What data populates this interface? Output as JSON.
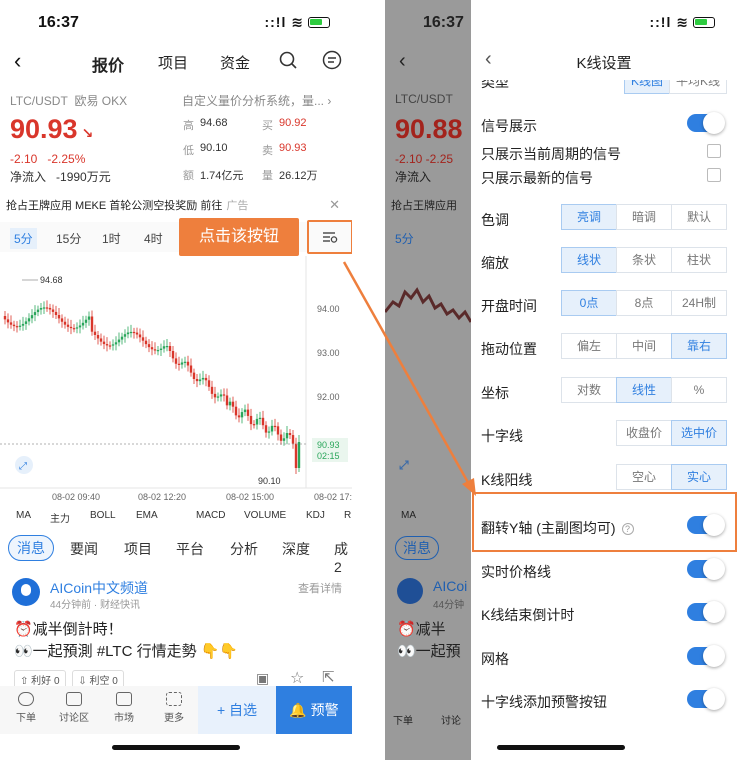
{
  "status": {
    "time": "16:37",
    "signal": "::!l"
  },
  "left": {
    "nav": {
      "tabs": [
        "报价",
        "项目",
        "资金"
      ]
    },
    "pair": "LTC/USDT",
    "exchange": "欧易 OKX",
    "custom_desc": "自定义量价分析系统，量...",
    "price": "90.93",
    "change_abs": "-2.10",
    "change_pct": "-2.25%",
    "net_inflow_label": "净流入",
    "net_inflow_value": "-1990万元",
    "stats": [
      {
        "k1": "高",
        "v1": "94.68",
        "k2": "买",
        "v2": "90.92"
      },
      {
        "k1": "低",
        "v1": "90.10",
        "k2": "卖",
        "v2": "90.93"
      },
      {
        "k1": "额",
        "v1": "1.74亿元",
        "k2": "量",
        "v2": "26.12万"
      }
    ],
    "ad_text": "抢占王牌应用 MEKE 首轮公测空投奖励 前往",
    "ad_tag": "广告",
    "periods": [
      "5分",
      "15分",
      "1时",
      "4时"
    ],
    "callout": "点击该按钮",
    "chart_labels": {
      "high": "94.68",
      "low": "90.10",
      "y_ticks": [
        "94.00",
        "93.00",
        "92.00"
      ],
      "last_price": "90.93",
      "countdown": "02:15",
      "x_ticks": [
        "08-02 09:40",
        "08-02 12:20",
        "08-02 15:00",
        "08-02 17:"
      ]
    },
    "indicators": [
      "MA",
      "主力",
      "BOLL",
      "EMA",
      "MACD",
      "VOLUME",
      "KDJ",
      "R"
    ],
    "news_tabs": [
      "消息",
      "要闻",
      "项目",
      "平台",
      "分析",
      "深度",
      "成2"
    ],
    "post": {
      "author": "AICoin中文频道",
      "meta": "44分钟前 · 财经快讯",
      "detail": "查看详情",
      "line1": "⏰减半倒計時！",
      "line2": "👀一起預測 #LTC 行情走勢 👇👇",
      "vote_up": "利好 0",
      "vote_down": "利空 0"
    },
    "bottom": [
      "下单",
      "讨论区",
      "市场",
      "更多"
    ],
    "btn_zixuan": "+ 自选",
    "btn_yujing": "🔔 预警"
  },
  "right": {
    "under_price": "90.88",
    "under_chg": "-2.10 -2.25",
    "under_flow": "净流入",
    "under_ad": "抢占王牌应用",
    "under_period": "5分",
    "under_news": "消息",
    "under_author": "AICoi",
    "under_meta": "44分钟",
    "under_line1": "⏰减半",
    "under_line2": "👀一起預",
    "under_bottom1": "下单",
    "under_bottom2": "讨论",
    "title": "K线设置",
    "type_label": "类型",
    "type_opts": [
      "K线图",
      "平均K线"
    ],
    "signal_label": "信号展示",
    "only_current": "只展示当前周期的信号",
    "only_latest": "只展示最新的信号",
    "tone_label": "色调",
    "tone_opts": [
      "亮调",
      "暗调",
      "默认"
    ],
    "zoom_label": "缩放",
    "zoom_opts": [
      "线状",
      "条状",
      "柱状"
    ],
    "open_label": "开盘时间",
    "open_opts": [
      "0点",
      "8点",
      "24H制"
    ],
    "drag_label": "拖动位置",
    "drag_opts": [
      "偏左",
      "中间",
      "靠右"
    ],
    "coord_label": "坐标",
    "coord_opts": [
      "对数",
      "线性",
      "%"
    ],
    "cross_label": "十字线",
    "cross_opts": [
      "收盘价",
      "选中价"
    ],
    "yang_label": "K线阳线",
    "yang_opts": [
      "空心",
      "实心"
    ],
    "flip_label": "翻转Y轴 (主副图均可)",
    "realtime_label": "实时价格线",
    "countdown_label": "K线结束倒计时",
    "grid_label": "网格",
    "cross_alert_label": "十字线添加预警按钮"
  },
  "colors": {
    "accent": "#2f7fe0",
    "up": "#2aa65b",
    "down": "#d9362b",
    "callout": "#ee7f3d"
  }
}
